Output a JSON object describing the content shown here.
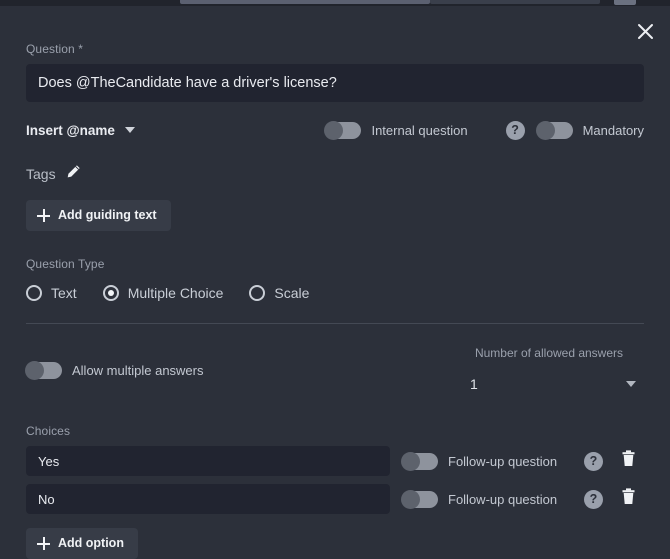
{
  "window": {
    "background_color": "#2c303a",
    "panel_color": "#2c303a",
    "input_color": "#212430",
    "accent_text_color": "#e9ebf0"
  },
  "header": {
    "close_icon": "close-icon"
  },
  "question": {
    "label": "Question *",
    "value": "Does @TheCandidate have a driver's license?",
    "placeholder": "Question"
  },
  "insert_name": {
    "label": "Insert @name",
    "caret_icon": "chevron-down-icon"
  },
  "toggles": {
    "internal_question": {
      "label": "Internal question",
      "state": "off"
    },
    "mandatory": {
      "label": "Mandatory",
      "state": "off",
      "help_icon": "question-mark-icon",
      "help_glyph": "?"
    }
  },
  "tags": {
    "label": "Tags",
    "edit_icon": "pencil-icon"
  },
  "guiding_text": {
    "label": "Add guiding text",
    "icon": "plus-icon"
  },
  "question_type": {
    "label": "Question Type",
    "options": [
      {
        "label": "Text",
        "selected": false
      },
      {
        "label": "Multiple Choice",
        "selected": true
      },
      {
        "label": "Scale",
        "selected": false
      }
    ]
  },
  "allow_multiple": {
    "label": "Allow multiple answers",
    "state": "off"
  },
  "allowed_answers": {
    "label": "Number of allowed answers",
    "value": "1",
    "caret_icon": "chevron-down-icon"
  },
  "choices": {
    "label": "Choices",
    "items": [
      {
        "value": "Yes",
        "followup_label": "Follow-up question",
        "followup_state": "off",
        "help_glyph": "?"
      },
      {
        "value": "No",
        "followup_label": "Follow-up question",
        "followup_state": "off",
        "help_glyph": "?"
      }
    ],
    "add_option_label": "Add option",
    "add_option_icon": "plus-icon"
  }
}
